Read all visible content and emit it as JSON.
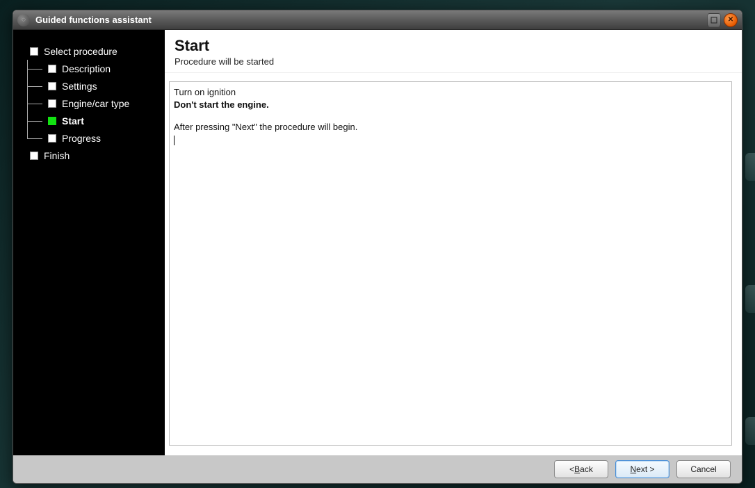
{
  "window": {
    "title": "Guided functions assistant"
  },
  "sidebar": {
    "items": [
      {
        "label": "Select procedure",
        "level": 0,
        "active": false,
        "bold": false
      },
      {
        "label": "Description",
        "level": 1,
        "active": false,
        "bold": false
      },
      {
        "label": "Settings",
        "level": 1,
        "active": false,
        "bold": false
      },
      {
        "label": "Engine/car type",
        "level": 1,
        "active": false,
        "bold": false
      },
      {
        "label": "Start",
        "level": 1,
        "active": true,
        "bold": true
      },
      {
        "label": "Progress",
        "level": 1,
        "active": false,
        "bold": false
      },
      {
        "label": "Finish",
        "level": 0,
        "active": false,
        "bold": false
      }
    ]
  },
  "main": {
    "title": "Start",
    "subtitle": "Procedure will be started",
    "instructions": {
      "line1": "Turn on ignition",
      "line2": "Don't start the engine.",
      "line3": "After pressing \"Next\" the procedure will begin."
    }
  },
  "footer": {
    "back_prefix": "< ",
    "back_letter": "B",
    "back_rest": "ack",
    "next_letter": "N",
    "next_rest": "ext >",
    "cancel": "Cancel"
  }
}
